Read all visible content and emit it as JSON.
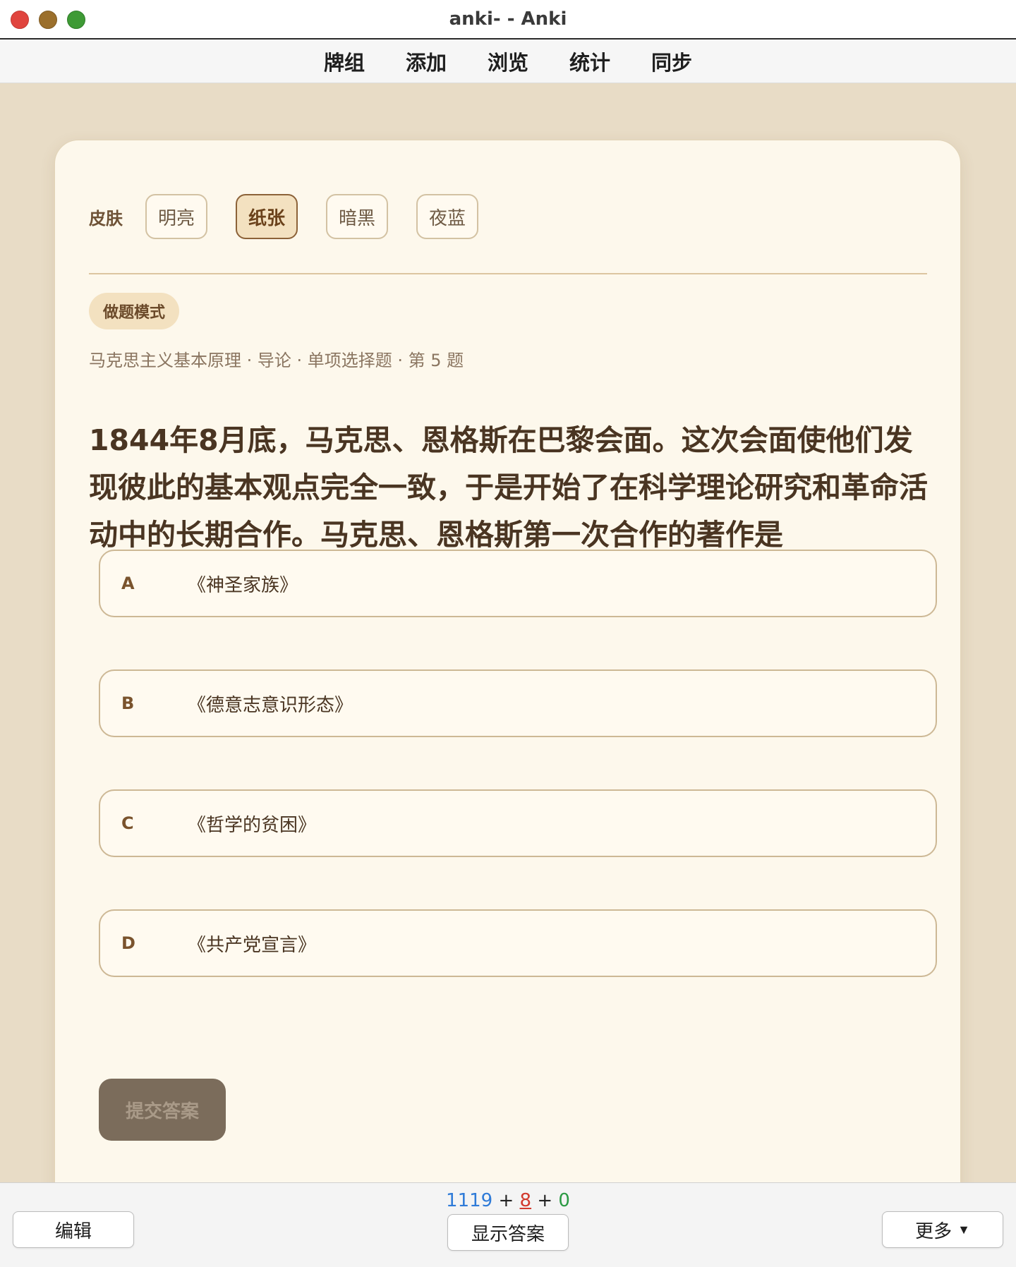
{
  "window": {
    "title": "anki- - Anki"
  },
  "menu": {
    "items": [
      "牌组",
      "添加",
      "浏览",
      "统计",
      "同步"
    ]
  },
  "skin": {
    "label": "皮肤",
    "options": [
      "明亮",
      "纸张",
      "暗黑",
      "夜蓝"
    ],
    "selected": "纸张"
  },
  "mode_badge": "做题模式",
  "breadcrumb": "马克思主义基本原理 · 导论 · 单项选择题 · 第 5 题",
  "question": "1844年8月底，马克思、恩格斯在巴黎会面。这次会面使他们发现彼此的基本观点完全一致，于是开始了在科学理论研究和革命活动中的长期合作。马克思、恩格斯第一次合作的著作是",
  "options": [
    {
      "letter": "A",
      "text": "《神圣家族》"
    },
    {
      "letter": "B",
      "text": "《德意志意识形态》"
    },
    {
      "letter": "C",
      "text": "《哲学的贫困》"
    },
    {
      "letter": "D",
      "text": "《共产党宣言》"
    }
  ],
  "submit_label": "提交答案",
  "bottom": {
    "counts": {
      "new": "1119",
      "learn": "8",
      "review": "0",
      "plus": "+"
    },
    "edit_label": "编辑",
    "show_answer_label": "显示答案",
    "more_label": "更多",
    "more_caret": "▼"
  },
  "colors": {
    "background": "#e8dcc6",
    "card": "#fdf8ec",
    "accent": "#8c6238",
    "count_new": "#2f7bd8",
    "count_learn": "#d23a2e",
    "count_review": "#2b9a43"
  }
}
